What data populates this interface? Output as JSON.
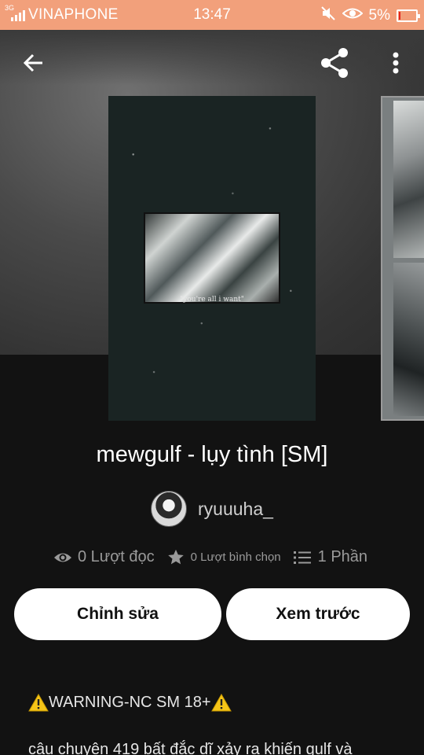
{
  "status_bar": {
    "network": "3G",
    "carrier": "VINAPHONE",
    "time": "13:47",
    "battery": "5%",
    "battery_level": 0.05,
    "icons": [
      "signal-icon",
      "mute-icon",
      "eye-icon",
      "battery-icon"
    ],
    "color": "#f2a07b"
  },
  "app_bar": {
    "icons": [
      "back-arrow-icon",
      "share-icon",
      "more-vert-icon"
    ]
  },
  "cover": {
    "caption": "\"you're all i want\""
  },
  "story": {
    "title": "mewgulf - lụy tình [SM]",
    "author": "ryuuuha_",
    "reads": "0 Lượt đọc",
    "votes": "0 Lượt bình chọn",
    "parts": "1 Phần"
  },
  "actions": {
    "edit_label": "Chỉnh sửa",
    "preview_label": "Xem trước"
  },
  "description": {
    "warning": "WARNING-NC SM 18+",
    "line2": "câu chuyện 419 bất đắc dĩ xảy ra khiến gulf và"
  },
  "colors": {
    "background": "#121212",
    "button_bg": "#ffffff",
    "warning_yellow": "#f5c518"
  }
}
